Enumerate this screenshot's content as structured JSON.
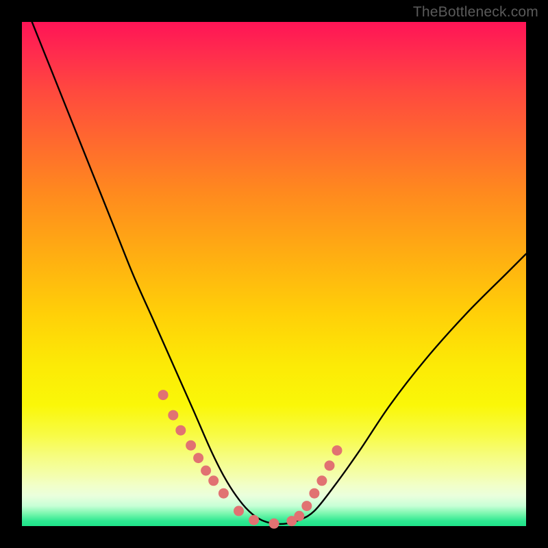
{
  "watermark": "TheBottleneck.com",
  "chart_data": {
    "type": "line",
    "title": "",
    "xlabel": "",
    "ylabel": "",
    "xlim": [
      0,
      100
    ],
    "ylim": [
      0,
      100
    ],
    "grid": false,
    "legend": false,
    "series": [
      {
        "name": "bottleneck-curve",
        "x": [
          2,
          6,
          10,
          14,
          18,
          22,
          26,
          30,
          34,
          37.5,
          40,
          42.5,
          45,
          47.5,
          50,
          52.5,
          55,
          58,
          62,
          67,
          73,
          80,
          88,
          96,
          100
        ],
        "y": [
          100,
          90,
          80,
          70,
          60,
          50,
          41,
          32,
          23,
          15,
          10,
          6,
          3,
          1.2,
          0.5,
          0.5,
          1.2,
          3,
          8,
          15,
          24,
          33,
          42,
          50,
          54
        ]
      }
    ],
    "markers": {
      "name": "highlight-dots",
      "x": [
        28,
        30,
        31.5,
        33.5,
        35,
        36.5,
        38,
        40,
        43,
        46,
        50,
        53.5,
        55,
        56.5,
        58,
        59.5,
        61,
        62.5
      ],
      "y": [
        26,
        22,
        19,
        16,
        13.5,
        11,
        9,
        6.5,
        3,
        1.2,
        0.5,
        1,
        2,
        4,
        6.5,
        9,
        12,
        15
      ]
    },
    "gradient_stops": [
      {
        "pos": 0,
        "color": "#ff1456"
      },
      {
        "pos": 50,
        "color": "#ffc400"
      },
      {
        "pos": 80,
        "color": "#f8fb46"
      },
      {
        "pos": 100,
        "color": "#1fe38a"
      }
    ]
  }
}
